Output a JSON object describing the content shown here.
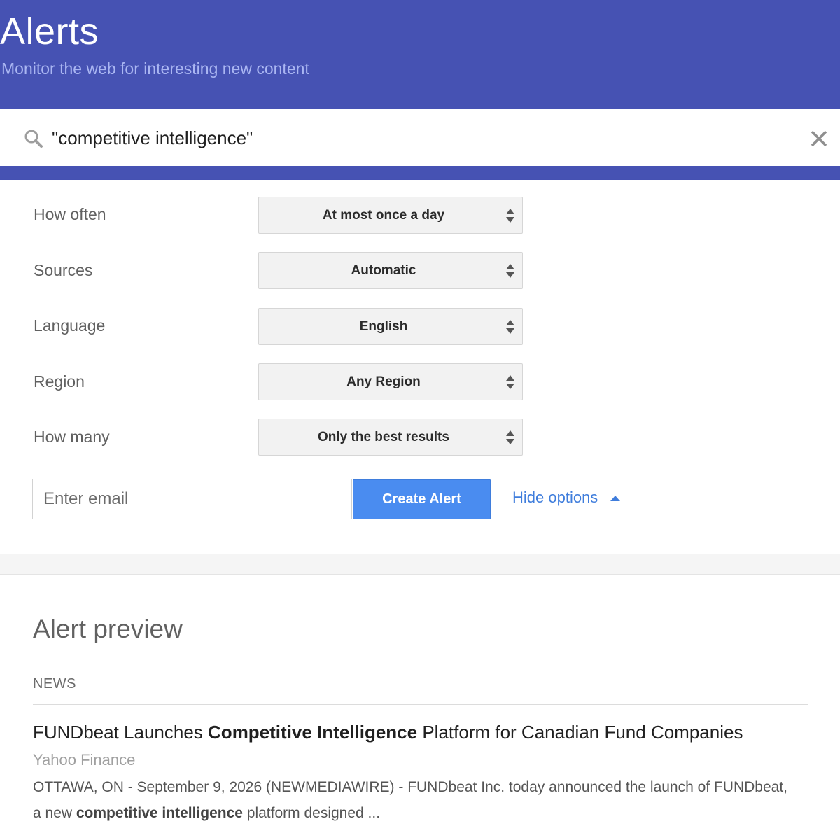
{
  "header": {
    "title": "Alerts",
    "subtitle": "Monitor the web for interesting new content"
  },
  "search": {
    "query": "\"competitive intelligence\""
  },
  "options": [
    {
      "label": "How often",
      "value": "At most once a day"
    },
    {
      "label": "Sources",
      "value": "Automatic"
    },
    {
      "label": "Language",
      "value": "English"
    },
    {
      "label": "Region",
      "value": "Any Region"
    },
    {
      "label": "How many",
      "value": "Only the best results"
    }
  ],
  "email": {
    "placeholder": "Enter email"
  },
  "create_label": "Create Alert",
  "hide_options_label": "Hide options",
  "preview": {
    "title": "Alert preview",
    "section": "NEWS",
    "result": {
      "title_pre": "FUNDbeat Launches ",
      "title_bold": "Competitive Intelligence",
      "title_post": " Platform for Canadian Fund Companies",
      "source": "Yahoo Finance",
      "snippet_line1": "OTTAWA, ON - September 9, 2026 (NEWMEDIAWIRE) - FUNDbeat Inc. today announced the launch of FUNDbeat,",
      "snippet_pre": "a new ",
      "snippet_bold": "competitive intelligence",
      "snippet_post": " platform designed ..."
    }
  },
  "colors": {
    "header_bg": "#4652b3",
    "accent_blue": "#4a8cf0",
    "link_blue": "#3f7ddc"
  }
}
